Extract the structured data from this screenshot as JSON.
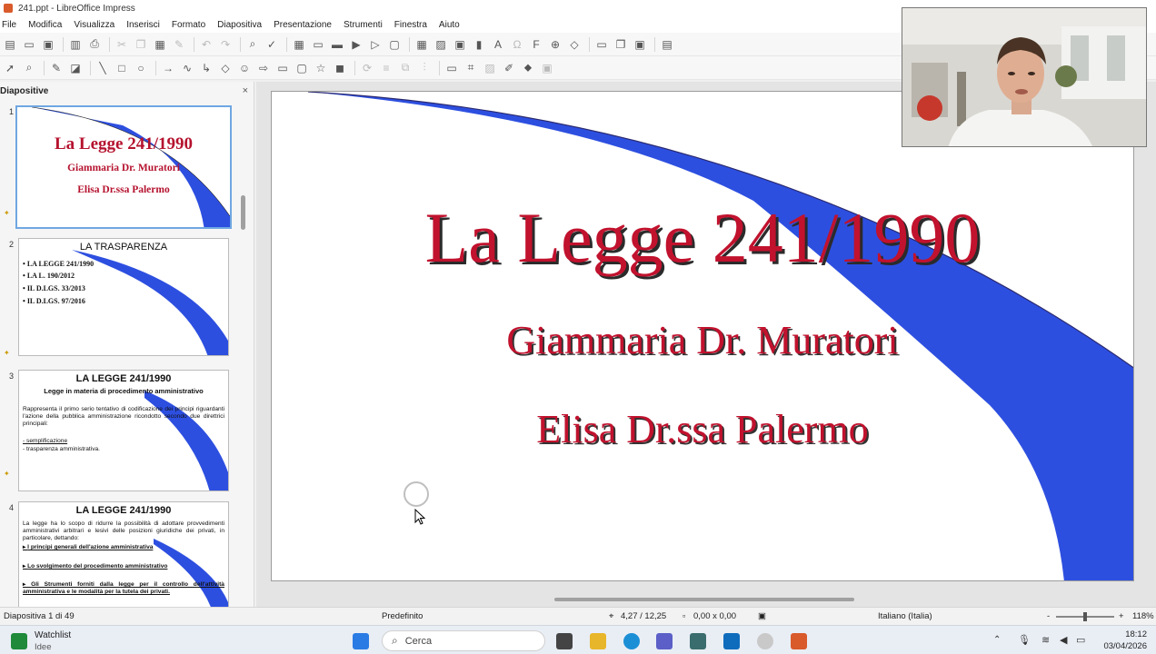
{
  "window": {
    "title": "241.ppt - LibreOffice Impress"
  },
  "menu": [
    "File",
    "Modifica",
    "Visualizza",
    "Inserisci",
    "Formato",
    "Diapositiva",
    "Presentazione",
    "Strumenti",
    "Finestra",
    "Aiuto"
  ],
  "slides_panel": {
    "title": "Diapositive",
    "close": "×",
    "slides": [
      {
        "number": "1",
        "title": "La Legge 241/1990",
        "lines": [
          "Giammaria Dr. Muratori",
          "Elisa Dr.ssa Palermo"
        ]
      },
      {
        "number": "2",
        "title": "LA TRASPARENZA",
        "bullets": [
          "LA LEGGE 241/1990",
          "LA L. 190/2012",
          "IL D.LGS. 33/2013",
          "IL D.LGS. 97/2016"
        ]
      },
      {
        "number": "3",
        "title": "LA LEGGE 241/1990",
        "subtitle": "Legge in materia di procedimento amministrativo",
        "body": "Rappresenta il primo serio tentativo di codificazione dei principi riguardanti l'azione della pubblica amministrazione ricondotto secondo due direttrici principali:",
        "items": [
          "- semplificazione",
          "- trasparenza amministrativa."
        ]
      },
      {
        "number": "4",
        "title": "LA LEGGE 241/1990",
        "body": "La legge ha lo scopo di ridurre la possibilità di adottare provvedimenti amministrativi arbitrari e lesivi delle posizioni giuridiche dei privati, in particolare, dettando:",
        "items": [
          "I principi generali dell'azione amministrativa",
          "Lo svolgimento del procedimento amministrativo",
          "Gli Strumenti forniti dalla legge per il controllo dell'attività amministrativa e le modalità per la tutela dei privati."
        ]
      }
    ]
  },
  "current_slide": {
    "title": "La Legge 241/1990",
    "subtitle1": "Giammaria Dr. Muratori",
    "subtitle2": "Elisa Dr.ssa Palermo"
  },
  "status": {
    "slide_info": "Diapositiva 1 di 49",
    "layout": "Predefinito",
    "position": "4,27 / 12,25",
    "size": "0,00 x 0,00",
    "language": "Italiano (Italia)",
    "zoom_minus": "-",
    "zoom_plus": "+",
    "zoom": "118%"
  },
  "taskbar": {
    "widget_title": "Watchlist",
    "widget_sub": "Idee",
    "search_placeholder": "Cerca",
    "time": "18:12",
    "date": "03/04/2026"
  },
  "colors": {
    "title_red": "#c1122e",
    "wedge_blue": "#2d4fe0",
    "selection": "#6fa7e2"
  }
}
